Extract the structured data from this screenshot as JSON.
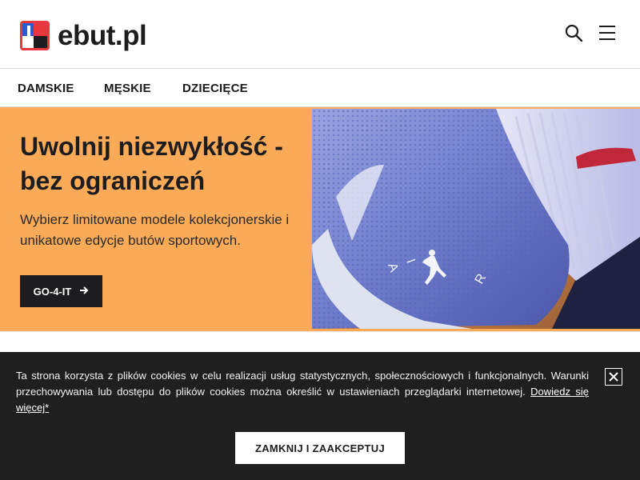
{
  "header": {
    "logo_text": "ebut.pl",
    "logo_colors": {
      "blue": "#2f5bd1",
      "red": "#e8383d",
      "dark": "#1d1d1f"
    },
    "icons": [
      "search-icon",
      "hamburger-menu-icon"
    ]
  },
  "nav": {
    "items": [
      {
        "label": "DAMSKIE"
      },
      {
        "label": "MĘSKIE"
      },
      {
        "label": "DZIECIĘCE"
      }
    ]
  },
  "hero": {
    "title": "Uwolnij niezwykłość - bez ograniczeń",
    "subtitle": "Wybierz limitowane modele kolekcjonerskie i unikatowe edycje butów sportowych.",
    "button_label": "GO-4-IT",
    "button_icon": "arrow-right-icon",
    "background_color": "#fbab57",
    "image_subject": "blue sneaker with jumpman logo and white sock"
  },
  "cookie": {
    "text": "Ta strona korzysta z plików cookies w celu realizacji usług statystycznych, społecznościowych i funkcjonalnych. Warunki przechowywania lub dostępu do plików cookies można określić w ustawieniach przeglądarki internetowej.",
    "link_label": "Dowiedz się więcej*",
    "accept_label": "ZAMKNIJ I ZAAKCEPTUJ",
    "close_icon": "close-icon",
    "background_color": "#1f1f1f"
  }
}
